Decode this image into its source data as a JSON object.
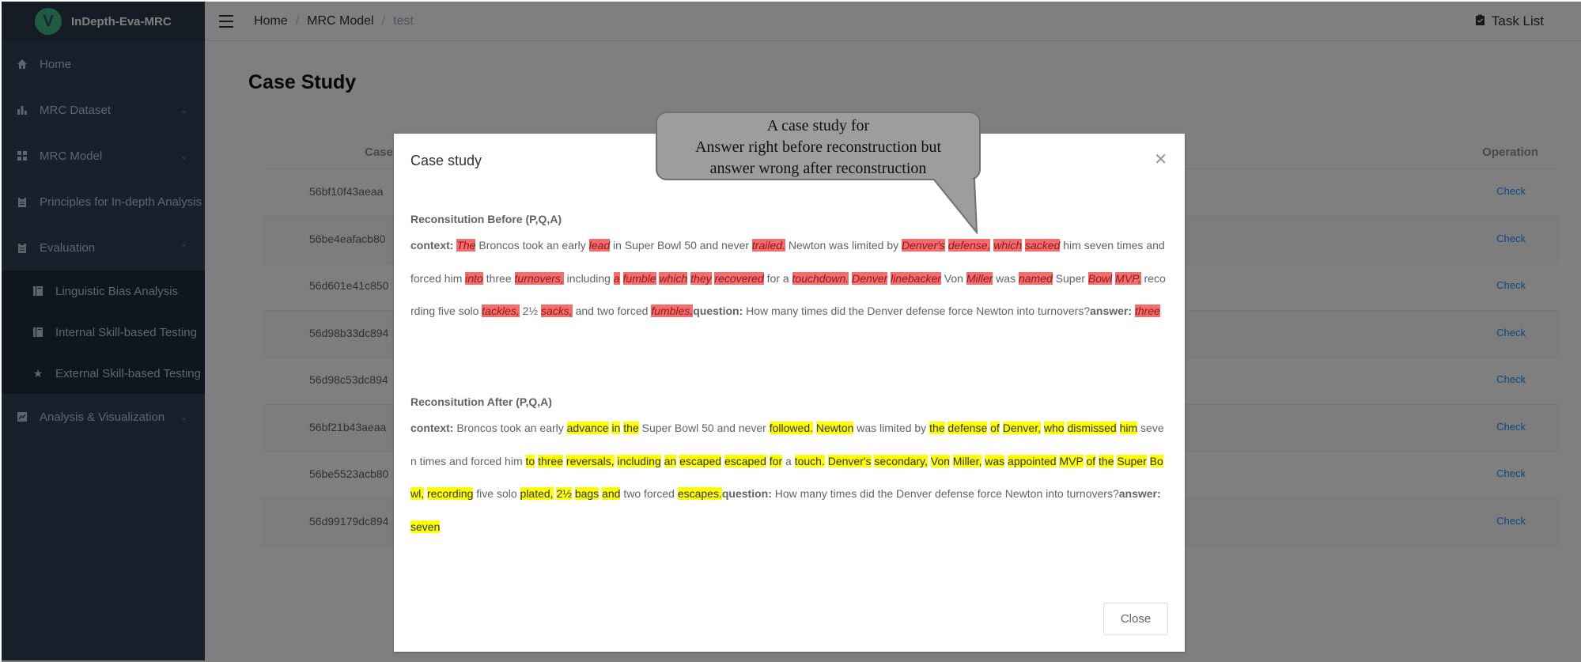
{
  "app": {
    "logo_letter": "V",
    "name": "InDepth-Eva-MRC"
  },
  "sidebar": {
    "items": [
      {
        "label": "Home",
        "icon": "home-icon"
      },
      {
        "label": "MRC Dataset",
        "icon": "bar-chart-icon"
      },
      {
        "label": "MRC Model",
        "icon": "grid-icon"
      },
      {
        "label": "Principles for In-depth Analysis",
        "icon": "clipboard-icon"
      },
      {
        "label": "Evaluation",
        "icon": "clipboard-icon"
      },
      {
        "label": "Linguistic Bias Analysis",
        "icon": "book-icon"
      },
      {
        "label": "Internal Skill-based Testing",
        "icon": "book-icon"
      },
      {
        "label": "External Skill-based Testing",
        "icon": "star-icon"
      },
      {
        "label": "Analysis & Visualization",
        "icon": "chart-icon"
      }
    ]
  },
  "header": {
    "breadcrumb": [
      "Home",
      "MRC Model",
      "test"
    ],
    "task_list": "Task List"
  },
  "page": {
    "title": "Case Study",
    "table": {
      "col_case": "Case",
      "col_operation": "Operation",
      "rows": [
        {
          "id": "56bf10f43aeaa",
          "action": "Check"
        },
        {
          "id": "56be4eafacb80",
          "action": "Check"
        },
        {
          "id": "56d601e41c850",
          "action": "Check"
        },
        {
          "id": "56d98b33dc894",
          "action": "Check"
        },
        {
          "id": "56d98c53dc894",
          "action": "Check"
        },
        {
          "id": "56bf21b43aeaa",
          "action": "Check"
        },
        {
          "id": "56be5523acb80",
          "action": "Check"
        },
        {
          "id": "56d99179dc894",
          "action": "Check"
        }
      ]
    }
  },
  "dialog": {
    "title": "Case study",
    "before_title": "Reconsitution Before (P,Q,A)",
    "after_title": "Reconsitution After (P,Q,A)",
    "labels": {
      "context": "context:",
      "question": "question:",
      "answer": "answer:"
    },
    "question_text": "How many times did the Denver defense force Newton into turnovers?",
    "before_answer": "three",
    "after_answer": "seven",
    "close_label": "Close",
    "highlight_colors": {
      "before": "#f56c6c",
      "after": "#ffff00"
    }
  },
  "annotation": {
    "line1": "A case study for",
    "line2": "Answer right before reconstruction but",
    "line3": "answer wrong after reconstruction"
  }
}
